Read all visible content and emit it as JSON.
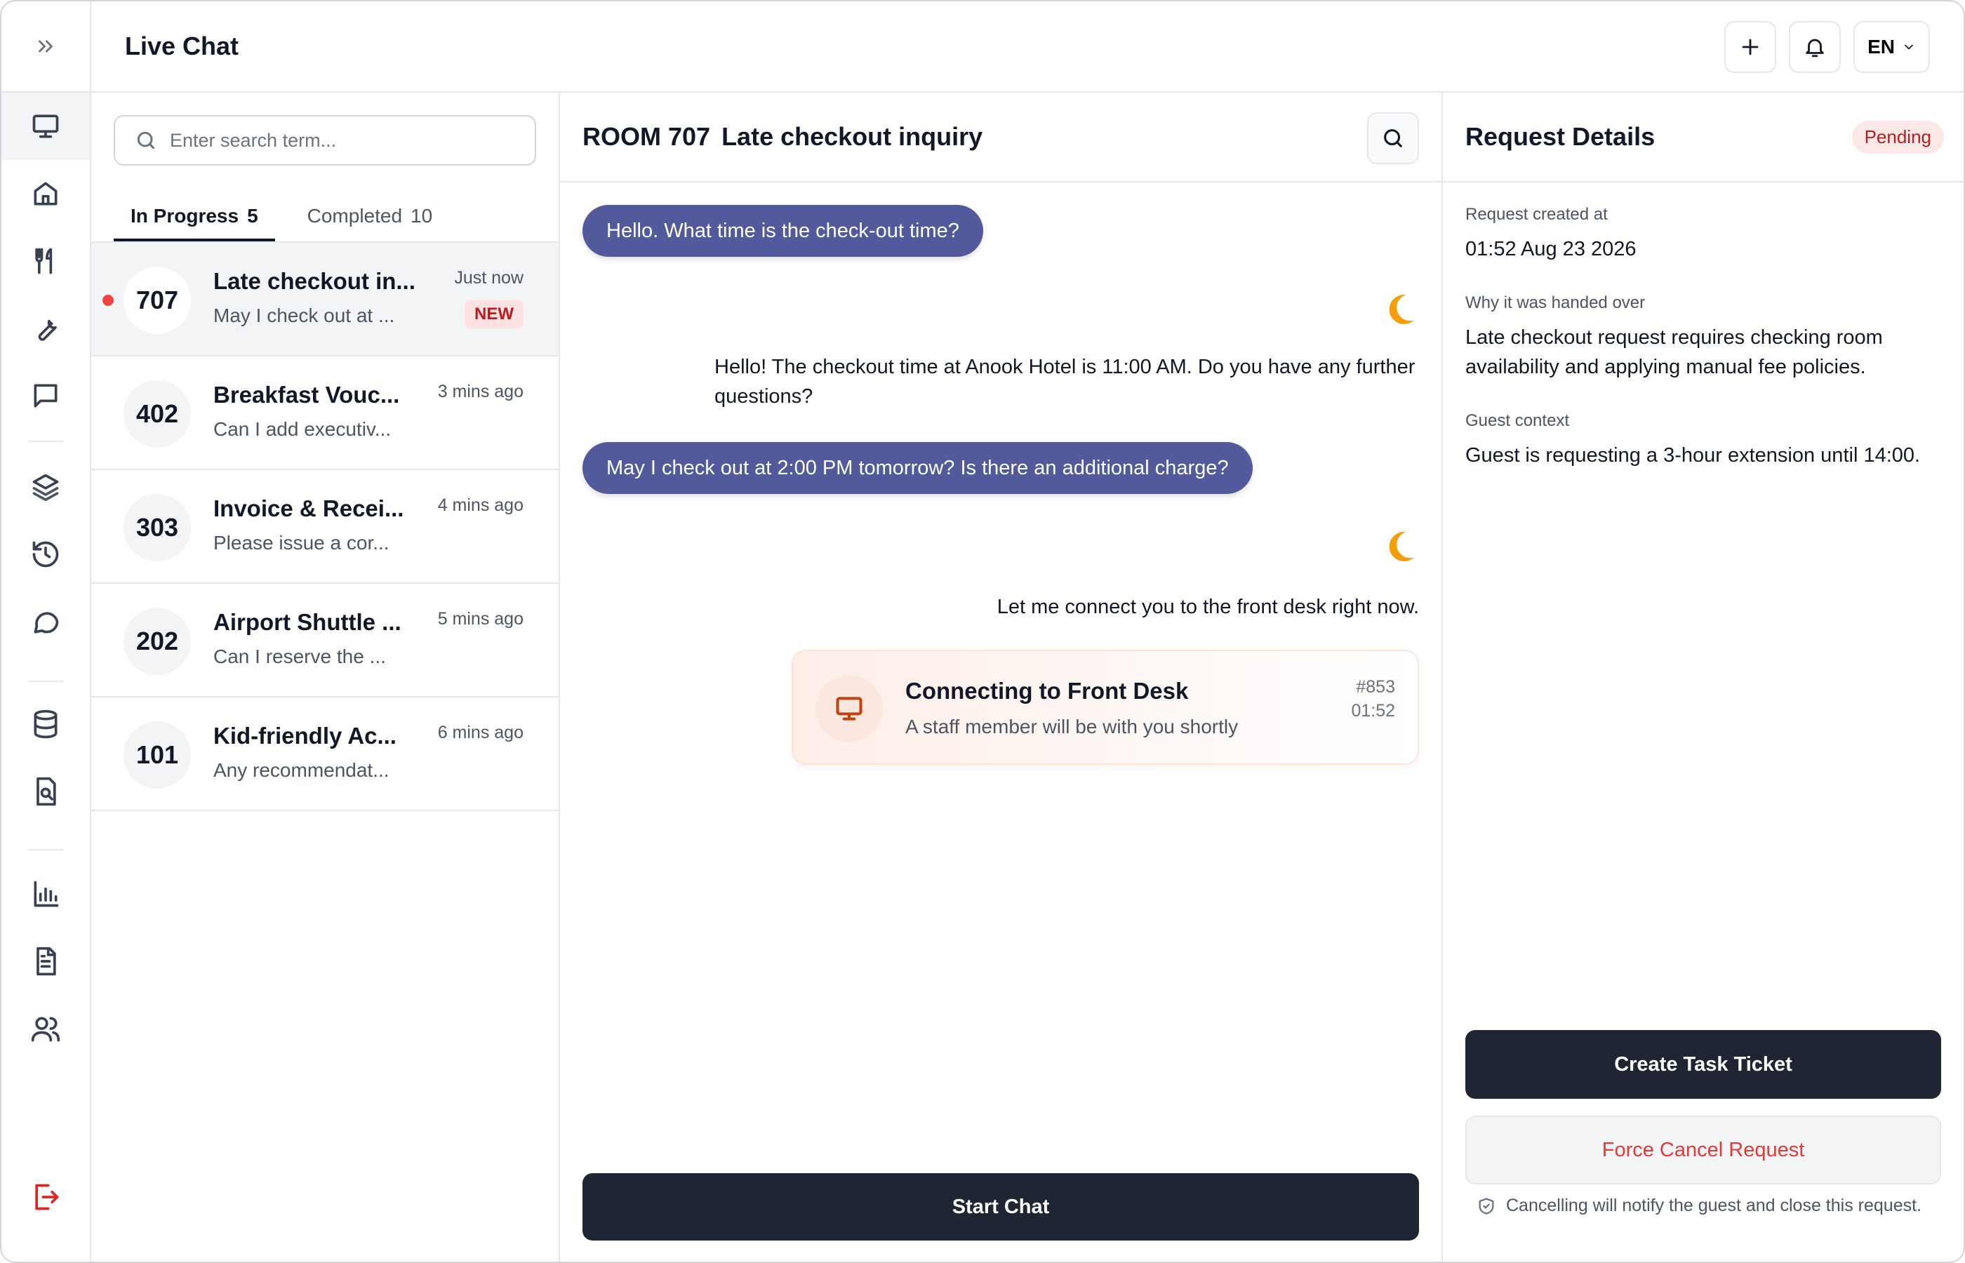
{
  "header": {
    "title": "Live Chat",
    "language": "EN"
  },
  "rail": {
    "items": [
      {
        "icon": "monitor-icon"
      },
      {
        "icon": "home-icon"
      },
      {
        "icon": "utensils-icon"
      },
      {
        "icon": "wrench-icon"
      },
      {
        "icon": "message-square-icon"
      },
      {
        "icon": "layers-icon"
      },
      {
        "icon": "history-icon"
      },
      {
        "icon": "message-circle-icon"
      },
      {
        "icon": "database-icon"
      },
      {
        "icon": "file-search-icon"
      },
      {
        "icon": "bar-chart-icon"
      },
      {
        "icon": "file-text-icon"
      },
      {
        "icon": "users-icon"
      },
      {
        "icon": "logout-icon"
      }
    ]
  },
  "list": {
    "search_placeholder": "Enter search term...",
    "tabs": [
      {
        "label": "In Progress",
        "count": "5"
      },
      {
        "label": "Completed",
        "count": "10"
      }
    ],
    "rows": [
      {
        "room": "707",
        "title": "Late checkout in...",
        "preview": "May I check out at ...",
        "time": "Just now",
        "badge": "NEW"
      },
      {
        "room": "402",
        "title": "Breakfast Vouc...",
        "preview": "Can I add executiv...",
        "time": "3 mins ago"
      },
      {
        "room": "303",
        "title": "Invoice & Recei...",
        "preview": "Please issue a cor...",
        "time": "4 mins ago"
      },
      {
        "room": "202",
        "title": "Airport Shuttle ...",
        "preview": "Can I reserve the ...",
        "time": "5 mins ago"
      },
      {
        "room": "101",
        "title": "Kid-friendly Ac...",
        "preview": "Any recommendat...",
        "time": "6 mins ago"
      }
    ]
  },
  "conversation": {
    "room": "ROOM 707",
    "topic": "Late checkout inquiry",
    "messages": [
      {
        "from": "guest",
        "text": "Hello. What time is the check-out time?"
      },
      {
        "from": "bot",
        "text": "Hello! The checkout time at Anook Hotel is 11:00 AM. Do you have any further questions?"
      },
      {
        "from": "guest",
        "text": "May I check out at 2:00 PM tomorrow? Is there an additional charge?"
      },
      {
        "from": "bot",
        "text": "Let me connect you to the front desk right now."
      }
    ],
    "handover": {
      "title": "Connecting to Front Desk",
      "subtitle": "A staff member will be with you shortly",
      "id": "#853",
      "time": "01:52"
    },
    "start_chat_label": "Start Chat"
  },
  "details": {
    "title": "Request Details",
    "status": "Pending",
    "created_label": "Request created at",
    "created_value": "01:52 Aug 23 2026",
    "reason_label": "Why it was handed over",
    "reason_value": "Late checkout request requires checking room availability and applying manual fee policies.",
    "context_label": "Guest context",
    "context_value": "Guest is requesting a 3-hour extension until 14:00.",
    "create_ticket_label": "Create Task Ticket",
    "force_cancel_label": "Force Cancel Request",
    "cancel_note": "Cancelling will notify the guest and close this request."
  },
  "colors": {
    "guest_bubble": "#525a9c",
    "primary_button": "#1f2533",
    "danger_text": "#e53935",
    "unread_dot": "#ef4444",
    "moon_icon": "#f59e0b"
  }
}
